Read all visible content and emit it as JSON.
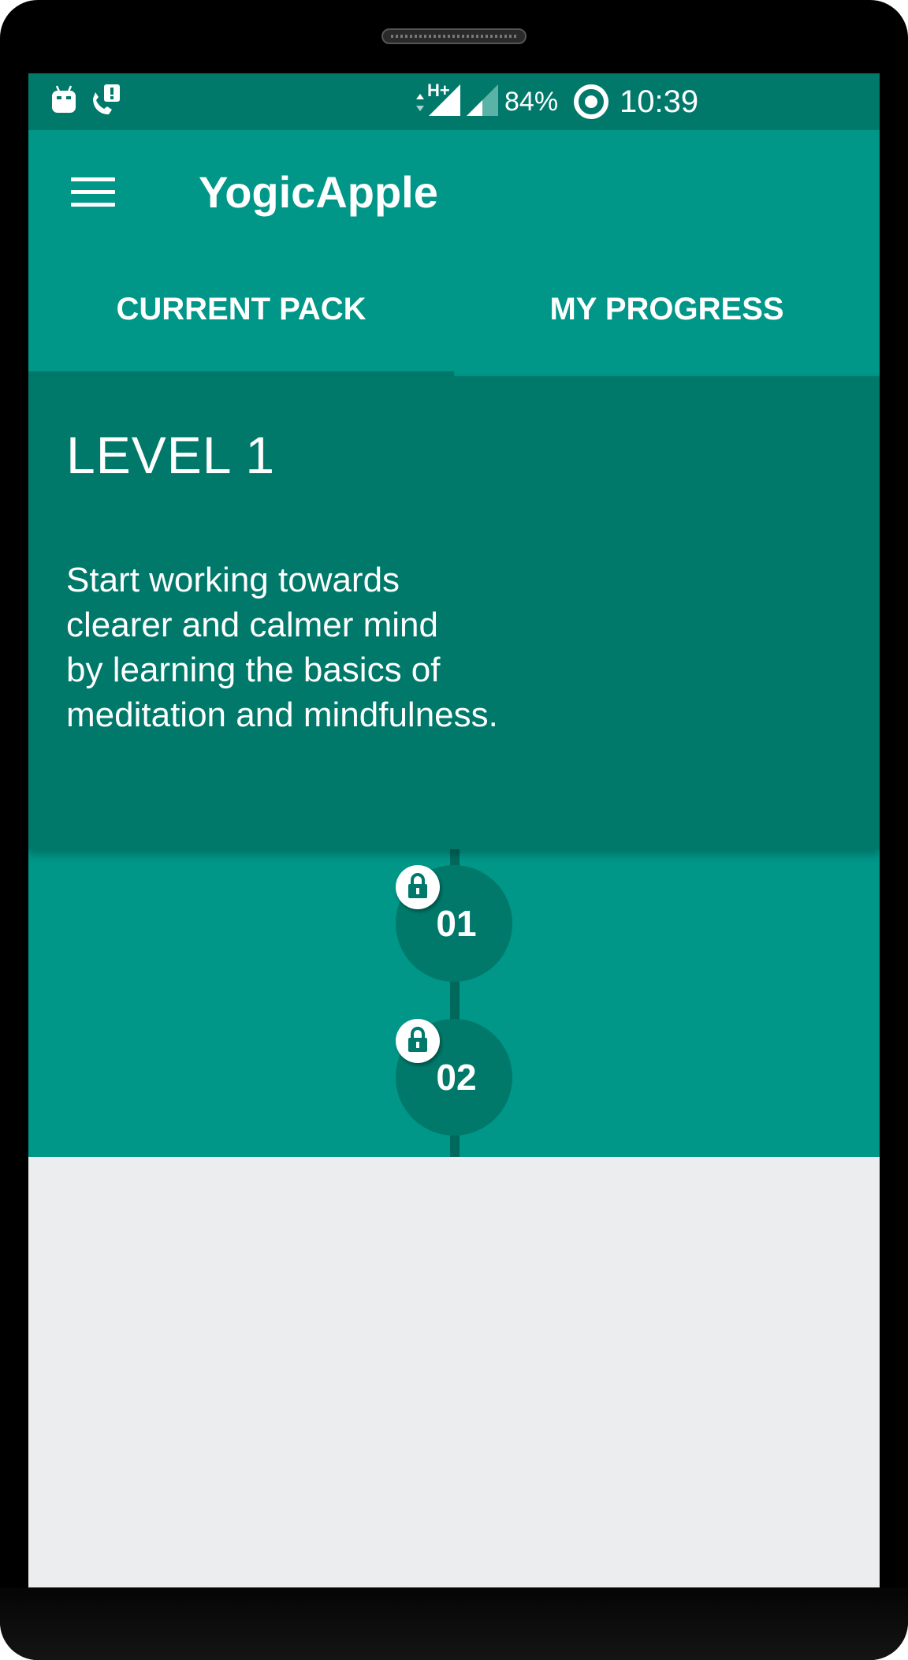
{
  "status_bar": {
    "network": "H+",
    "battery": "84%",
    "time": "10:39"
  },
  "app_bar": {
    "title": "YogicApple",
    "menu_icon": "hamburger-menu-icon"
  },
  "tabs": [
    {
      "label": "CURRENT PACK",
      "selected": true
    },
    {
      "label": "MY PROGRESS",
      "selected": false
    }
  ],
  "level": {
    "title": "LEVEL 1",
    "description_lines": [
      "Start working towards",
      "clearer and calmer mind",
      "by learning the basics of",
      "meditation and mindfulness."
    ]
  },
  "sessions": [
    {
      "number": "01",
      "locked": true
    },
    {
      "number": "02",
      "locked": true
    }
  ],
  "colors": {
    "primary": "#009688",
    "primary_dark": "#00796b",
    "background": "#ecedee"
  }
}
